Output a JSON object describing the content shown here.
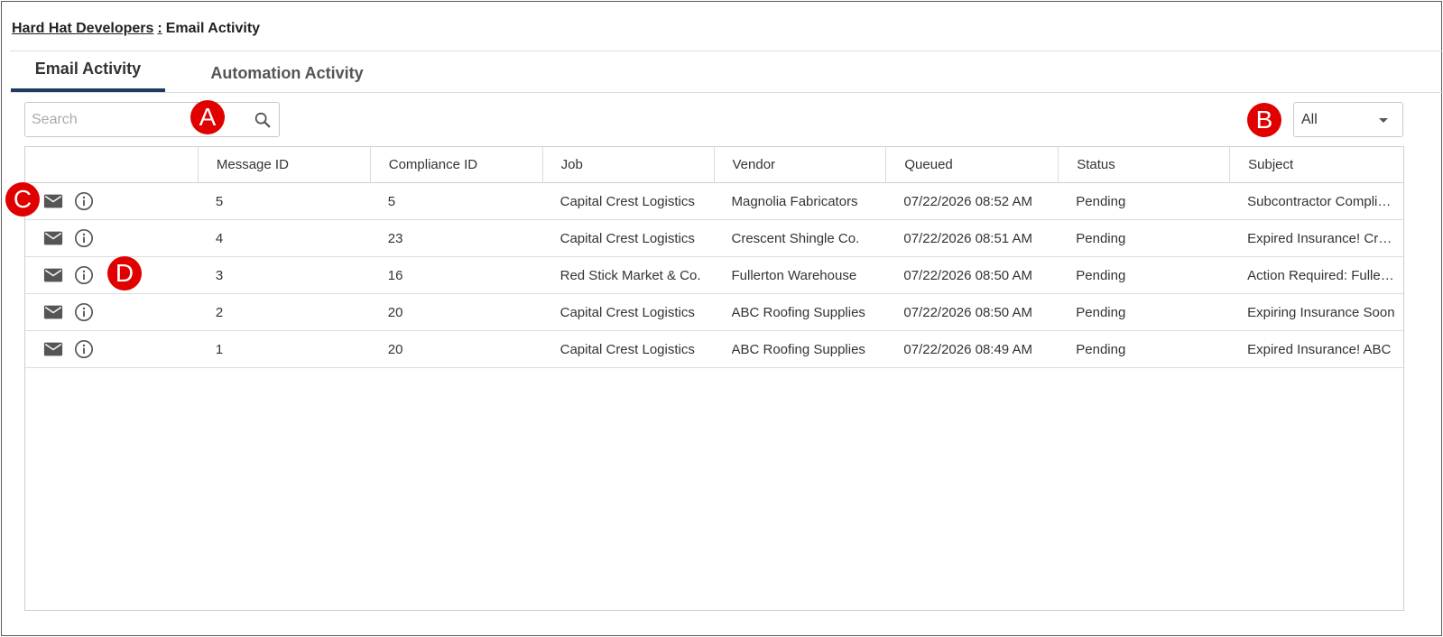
{
  "breadcrumb": {
    "company": "Hard Hat Developers",
    "separator": ":",
    "page": "Email Activity"
  },
  "tabs": [
    {
      "label": "Email Activity",
      "active": true
    },
    {
      "label": "Automation Activity",
      "active": false
    }
  ],
  "search": {
    "placeholder": "Search",
    "value": "",
    "icon": "search-icon"
  },
  "filter": {
    "selected": "All"
  },
  "grid": {
    "columns": [
      "",
      "Message ID",
      "Compliance ID",
      "Job",
      "Vendor",
      "Queued",
      "Status",
      "Subject"
    ],
    "rows": [
      {
        "message_id": "5",
        "compliance_id": "5",
        "job": "Capital Crest Logistics",
        "vendor": "Magnolia Fabricators",
        "queued": "07/22/2026 08:52 AM",
        "status": "Pending",
        "subject": "Subcontractor Compliance"
      },
      {
        "message_id": "4",
        "compliance_id": "23",
        "job": "Capital Crest Logistics",
        "vendor": "Crescent Shingle Co.",
        "queued": "07/22/2026 08:51 AM",
        "status": "Pending",
        "subject": "Expired Insurance! Crescent"
      },
      {
        "message_id": "3",
        "compliance_id": "16",
        "job": "Red Stick Market & Co.",
        "vendor": "Fullerton Warehouse",
        "queued": "07/22/2026 08:50 AM",
        "status": "Pending",
        "subject": "Action Required: Fullerton"
      },
      {
        "message_id": "2",
        "compliance_id": "20",
        "job": "Capital Crest Logistics",
        "vendor": "ABC Roofing Supplies",
        "queued": "07/22/2026 08:50 AM",
        "status": "Pending",
        "subject": "Expiring Insurance Soon"
      },
      {
        "message_id": "1",
        "compliance_id": "20",
        "job": "Capital Crest Logistics",
        "vendor": "ABC Roofing Supplies",
        "queued": "07/22/2026 08:49 AM",
        "status": "Pending",
        "subject": "Expired Insurance! ABC"
      }
    ]
  },
  "annotations": [
    "A",
    "B",
    "C",
    "D"
  ],
  "colors": {
    "accent": "#1f3a5f",
    "badge": "#e00000"
  }
}
